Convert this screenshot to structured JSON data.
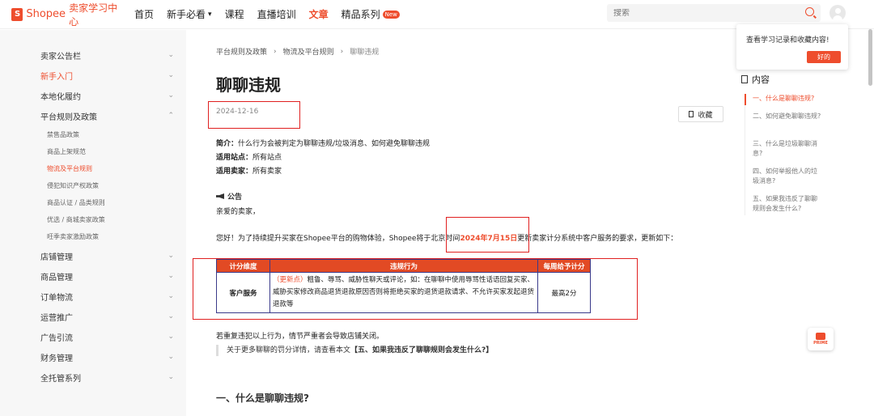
{
  "header": {
    "brand": "Shopee",
    "brand_sub": "卖家学习中心",
    "nav": [
      {
        "label": "首页"
      },
      {
        "label": "新手必看"
      },
      {
        "label": "课程"
      },
      {
        "label": "直播培训"
      },
      {
        "label": "文章"
      },
      {
        "label": "精品系列"
      }
    ],
    "new_badge": "New",
    "search_placeholder": "搜索"
  },
  "sidebar": {
    "items": [
      {
        "label": "卖家公告栏"
      },
      {
        "label": "新手入门"
      },
      {
        "label": "本地化履约"
      },
      {
        "label": "平台规则及政策"
      },
      {
        "label": "店铺管理"
      },
      {
        "label": "商品管理"
      },
      {
        "label": "订单物流"
      },
      {
        "label": "运营推广"
      },
      {
        "label": "广告引流"
      },
      {
        "label": "财务管理"
      },
      {
        "label": "全托管系列"
      }
    ],
    "sub_items": [
      {
        "label": "禁售品政策"
      },
      {
        "label": "商品上架规范"
      },
      {
        "label": "物流及平台规则"
      },
      {
        "label": "侵犯知识产权政策"
      },
      {
        "label": "商品认证 / 品类规则"
      },
      {
        "label": "优选 / 商城卖家政策"
      },
      {
        "label": "旺季卖家激励政策"
      }
    ]
  },
  "breadcrumb": [
    "平台规则及政策",
    "物流及平台规则",
    "聊聊违规"
  ],
  "article": {
    "title": "聊聊违规",
    "date": "2024-12-16",
    "favorite_label": "收藏",
    "intro_label": "简介：",
    "intro_text": "什么行为会被判定为聊聊违规/垃圾消息、如何避免聊聊违规",
    "sites_label": "适用站点：",
    "sites_text": "所有站点",
    "sellers_label": "适用卖家：",
    "sellers_text": "所有卖家",
    "notice_title": "公告",
    "greeting": "亲爱的卖家，",
    "para_before": "您好！为了持续提升买家在Shopee平台的购物体验，Shopee将于北京时间",
    "para_date": "2024年7月15日",
    "para_after": "更新卖家计分系统中客户服务的要求，更新如下：",
    "table": {
      "headers": [
        "计分维度",
        "违规行为",
        "每周给予计分"
      ],
      "row": {
        "dimension": "客户服务",
        "rule_tag": "（更新点）",
        "rule_text": "粗鲁、辱骂、威胁性聊天或评论，如：在聊聊中使用辱骂性话语回复买家、威胁买家修改商品退货退款原因否则将拒绝买家的退货退款请求、不允许买家发起退货退款等",
        "points": "最高2分"
      }
    },
    "after_table": "若重复违犯以上行为，情节严重者会导致店铺关闭。",
    "quote_prefix": "关于更多聊聊的罚分详情，请查看本文",
    "quote_link": "【五、如果我违反了聊聊规则会发生什么?】",
    "section1": "一、什么是聊聊违规?"
  },
  "toc": {
    "title": "内容",
    "items": [
      {
        "label": "一、什么是聊聊违规?"
      },
      {
        "label": "二、如何避免聊聊违规?"
      },
      {
        "label": "三、什么是垃圾聊聊消息?"
      },
      {
        "label": "四、如何举报他人的垃圾消息?"
      },
      {
        "label": "五、如果我违反了聊聊规则会发生什么?"
      }
    ]
  },
  "popup": {
    "text": "查看学习记录和收藏内容!",
    "button": "好的"
  },
  "prime_label": "PRIME"
}
